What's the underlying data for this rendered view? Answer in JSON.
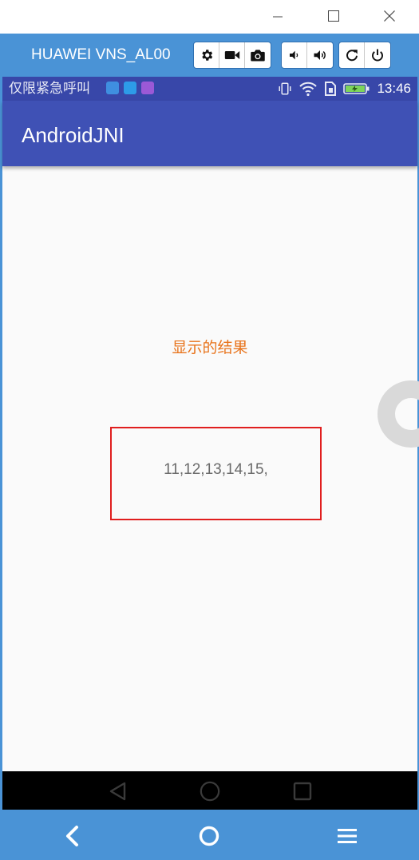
{
  "window": {
    "controls": {
      "minimize_icon": "minimize-icon",
      "maximize_icon": "maximize-icon",
      "close_icon": "close-icon"
    }
  },
  "device_toolbar": {
    "device_name": "HUAWEI VNS_AL00",
    "buttons": [
      {
        "icon": "settings-icon"
      },
      {
        "icon": "video-record-icon"
      },
      {
        "icon": "camera-icon"
      },
      {
        "icon": "volume-down-icon"
      },
      {
        "icon": "volume-up-icon"
      },
      {
        "icon": "rotate-icon"
      },
      {
        "icon": "power-icon"
      }
    ],
    "color": "#4a93d6"
  },
  "status_bar": {
    "carrier_text": "仅限紧急呼叫",
    "time": "13:46",
    "color": "#3847a9"
  },
  "app_bar": {
    "title": "AndroidJNI",
    "color": "#3f51b5"
  },
  "content": {
    "result_label": "显示的结果",
    "result_value": "11,12,13,14,15,",
    "label_color": "#e8741c",
    "box_border_color": "#e01e1e"
  },
  "android_nav": {
    "back_icon": "back-triangle-icon",
    "home_icon": "home-circle-icon",
    "recents_icon": "recents-square-icon"
  },
  "bottom_bar": {
    "back_icon": "chevron-left-icon",
    "home_icon": "circle-icon",
    "menu_icon": "hamburger-menu-icon"
  }
}
